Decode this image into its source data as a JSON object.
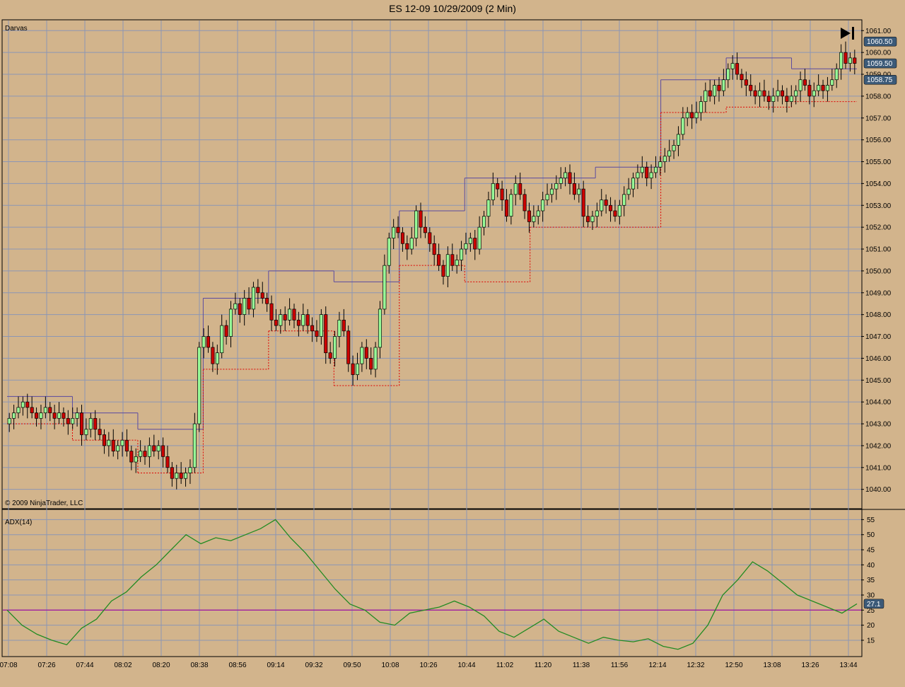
{
  "window": {
    "title": "ES 12-09  10/29/2009 (2 Min)",
    "copyright": "© 2009 NinjaTrader, LLC",
    "nav_icon": "skip-to-end-icon"
  },
  "colors": {
    "background": "#d2b48c",
    "grid": "#8c96b4",
    "up_candle": "#98fb98",
    "down_candle": "#cc0000",
    "box_top": "#5a4aa0",
    "box_bottom": "#e00000",
    "adx_line": "#228b22",
    "adx_ref_line": "#a020a0",
    "label_box": "#3c5a78"
  },
  "chart_data": [
    {
      "type": "candlestick",
      "title": "Darvas",
      "ylim": [
        1039.6,
        1061.3
      ],
      "y_ticks": [
        "1040.00",
        "1041.00",
        "1042.00",
        "1043.00",
        "1044.00",
        "1045.00",
        "1046.00",
        "1047.00",
        "1048.00",
        "1049.00",
        "1050.00",
        "1051.00",
        "1052.00",
        "1053.00",
        "1054.00",
        "1055.00",
        "1056.00",
        "1057.00",
        "1058.00",
        "1059.00",
        "1060.00",
        "1061.00"
      ],
      "price_labels": [
        "1060.50",
        "1059.50",
        "1058.75"
      ],
      "x_ticks": [
        "07:08",
        "07:26",
        "07:44",
        "08:02",
        "08:20",
        "08:38",
        "08:56",
        "09:14",
        "09:32",
        "09:50",
        "10:08",
        "10:26",
        "10:44",
        "11:02",
        "11:20",
        "11:38",
        "11:56",
        "12:14",
        "12:32",
        "12:50",
        "13:08",
        "13:26",
        "13:44"
      ],
      "closes": [
        1043.25,
        1043.5,
        1043.75,
        1044.0,
        1043.75,
        1043.5,
        1043.25,
        1043.5,
        1043.75,
        1043.5,
        1043.25,
        1043.5,
        1043.25,
        1043.0,
        1043.25,
        1043.5,
        1042.5,
        1042.75,
        1043.25,
        1042.75,
        1042.5,
        1042.0,
        1042.25,
        1041.75,
        1042.0,
        1042.25,
        1041.75,
        1041.25,
        1041.5,
        1041.75,
        1041.5,
        1042.0,
        1041.75,
        1042.0,
        1041.5,
        1041.0,
        1040.5,
        1040.75,
        1040.5,
        1040.75,
        1041.0,
        1043.0,
        1046.5,
        1047.0,
        1046.5,
        1045.75,
        1046.25,
        1047.5,
        1047.0,
        1048.25,
        1048.5,
        1048.0,
        1048.75,
        1048.25,
        1049.25,
        1049.0,
        1048.75,
        1048.5,
        1047.75,
        1047.5,
        1048.0,
        1047.75,
        1048.25,
        1047.75,
        1047.5,
        1048.0,
        1047.5,
        1047.25,
        1047.0,
        1048.0,
        1046.25,
        1046.0,
        1047.0,
        1047.75,
        1047.25,
        1045.75,
        1045.25,
        1045.75,
        1046.5,
        1046.0,
        1045.5,
        1046.5,
        1048.25,
        1050.25,
        1051.5,
        1052.0,
        1051.75,
        1051.25,
        1051.0,
        1051.5,
        1052.75,
        1052.0,
        1051.75,
        1051.25,
        1050.75,
        1050.25,
        1049.75,
        1050.75,
        1050.25,
        1050.5,
        1051.0,
        1051.25,
        1051.5,
        1051.0,
        1052.0,
        1052.5,
        1053.25,
        1054.0,
        1053.75,
        1053.25,
        1052.5,
        1053.5,
        1054.0,
        1053.5,
        1052.75,
        1052.25,
        1052.5,
        1052.75,
        1053.25,
        1053.5,
        1053.75,
        1054.0,
        1054.25,
        1054.5,
        1054.0,
        1053.5,
        1053.75,
        1052.5,
        1052.25,
        1052.5,
        1052.75,
        1053.25,
        1053.0,
        1052.75,
        1052.5,
        1053.0,
        1053.5,
        1053.75,
        1054.25,
        1054.5,
        1054.75,
        1054.25,
        1054.5,
        1054.75,
        1055.0,
        1055.25,
        1055.5,
        1055.75,
        1056.25,
        1057.0,
        1057.25,
        1057.0,
        1057.25,
        1057.75,
        1058.25,
        1058.0,
        1058.5,
        1058.25,
        1058.75,
        1059.25,
        1059.5,
        1059.0,
        1058.75,
        1058.5,
        1058.25,
        1058.0,
        1058.25,
        1058.0,
        1057.75,
        1058.0,
        1058.25,
        1058.0,
        1057.75,
        1058.0,
        1058.25,
        1058.75,
        1058.5,
        1058.0,
        1058.25,
        1058.5,
        1058.25,
        1058.5,
        1058.75,
        1059.25,
        1060.0,
        1059.5,
        1059.75,
        1059.5
      ],
      "darvas_boxes": [
        {
          "top": 1044.25,
          "bottom": 1043.0
        },
        {
          "top": 1043.5,
          "bottom": 1042.25
        },
        {
          "top": 1042.75,
          "bottom": 1040.75
        },
        {
          "top": 1048.75,
          "bottom": 1045.5
        },
        {
          "top": 1050.0,
          "bottom": 1047.25
        },
        {
          "top": 1049.5,
          "bottom": 1044.75
        },
        {
          "top": 1052.75,
          "bottom": 1050.25
        },
        {
          "top": 1054.25,
          "bottom": 1049.5
        },
        {
          "top": 1054.25,
          "bottom": 1052.0
        },
        {
          "top": 1054.75,
          "bottom": 1052.0
        },
        {
          "top": 1058.75,
          "bottom": 1057.25
        },
        {
          "top": 1059.75,
          "bottom": 1057.5
        },
        {
          "top": 1059.25,
          "bottom": 1057.75
        }
      ]
    },
    {
      "type": "line",
      "title": "ADX(14)",
      "ylim": [
        11,
        56.5
      ],
      "y_ticks": [
        "15",
        "20",
        "25",
        "30",
        "35",
        "40",
        "45",
        "50",
        "55"
      ],
      "current_value_label": "27.1",
      "reference_level": 25,
      "x_ticks": [
        "07:08",
        "07:26",
        "07:44",
        "08:02",
        "08:20",
        "08:38",
        "08:56",
        "09:14",
        "09:32",
        "09:50",
        "10:08",
        "10:26",
        "10:44",
        "11:02",
        "11:20",
        "11:38",
        "11:56",
        "12:14",
        "12:32",
        "12:50",
        "13:08",
        "13:26",
        "13:44"
      ],
      "values": [
        25,
        20,
        17,
        15,
        13.5,
        19,
        22,
        28,
        31,
        36,
        40,
        45,
        50,
        47,
        49,
        48,
        50,
        52,
        55,
        49,
        44,
        38,
        32,
        27,
        25,
        21,
        20,
        24,
        25,
        26,
        28,
        26,
        23,
        18,
        16,
        19,
        22,
        18,
        16,
        14,
        16,
        15,
        14.5,
        15.5,
        13,
        12,
        14,
        20,
        30,
        35,
        41,
        38,
        34,
        30,
        28,
        26,
        24,
        27.1
      ]
    }
  ]
}
